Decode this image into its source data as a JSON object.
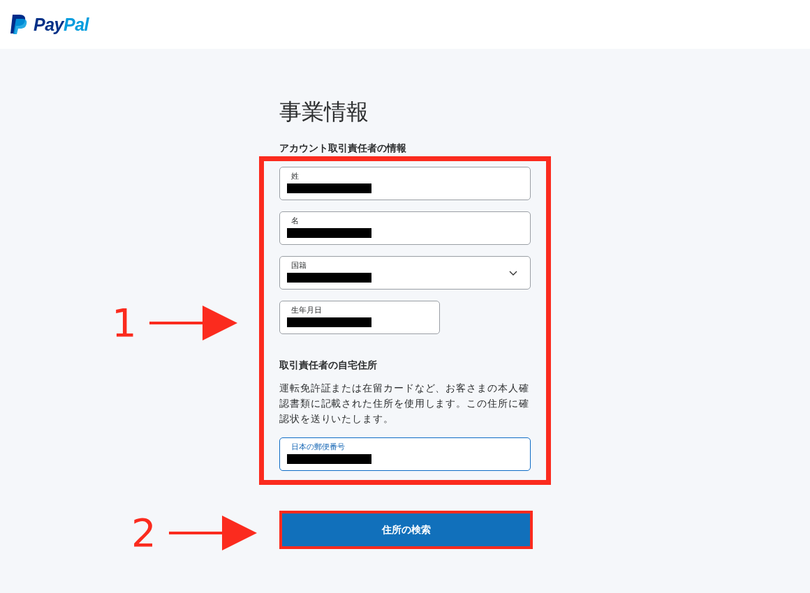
{
  "header": {
    "logo": "PayPal"
  },
  "title": "事業情報",
  "section_1": {
    "heading": "アカウント取引責任者の情報",
    "fields": [
      {
        "kind": "text",
        "label": "姓",
        "focused": false,
        "redacted": true
      },
      {
        "kind": "text",
        "label": "名",
        "focused": false,
        "redacted": true
      },
      {
        "kind": "select",
        "label": "国籍",
        "focused": false,
        "redacted": true
      },
      {
        "kind": "date",
        "label": "生年月日",
        "focused": false,
        "redacted": true
      }
    ]
  },
  "section_2": {
    "heading": "取引責任者の自宅住所",
    "description": "運転免許証または在留カードなど、お客さまの本人確認書類に記載された住所を使用します。この住所に確認状を送りいたします。",
    "fields": [
      {
        "kind": "text",
        "label": "日本の郵便番号",
        "focused": true,
        "redacted": true
      }
    ]
  },
  "button": {
    "label": "住所の検索"
  },
  "annotations": [
    {
      "number": "1"
    },
    {
      "number": "2"
    }
  ]
}
